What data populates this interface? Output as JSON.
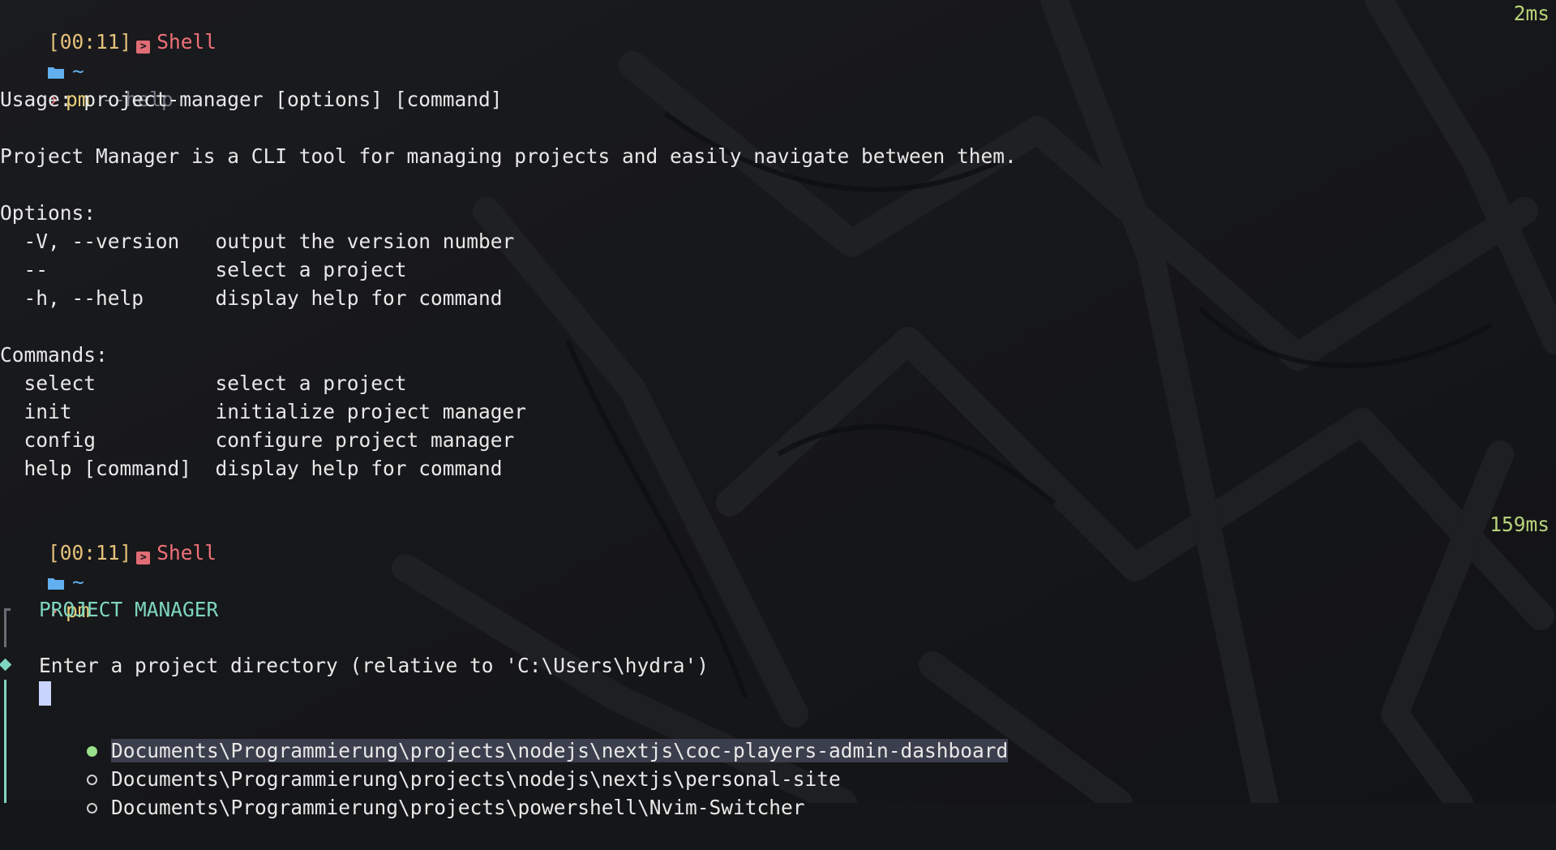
{
  "blocks": [
    {
      "time": "[00:11]",
      "shell": "Shell",
      "duration": "2ms",
      "cwd": "~",
      "command": "pm",
      "args": "--help"
    },
    {
      "time": "[00:11]",
      "shell": "Shell",
      "duration": "159ms",
      "cwd": "~",
      "command": "pm",
      "args": ""
    }
  ],
  "help": {
    "usage": "Usage: project-manager [options] [command]",
    "description": "Project Manager is a CLI tool for managing projects and easily navigate between them.",
    "options_header": "Options:",
    "options": [
      {
        "flag": "  -V, --version   ",
        "desc": "output the version number"
      },
      {
        "flag": "  --              ",
        "desc": "select a project"
      },
      {
        "flag": "  -h, --help      ",
        "desc": "display help for command"
      }
    ],
    "commands_header": "Commands:",
    "commands": [
      {
        "name": "  select          ",
        "desc": "select a project"
      },
      {
        "name": "  init            ",
        "desc": "initialize project manager"
      },
      {
        "name": "  config          ",
        "desc": "configure project manager"
      },
      {
        "name": "  help [command]  ",
        "desc": "display help for command"
      }
    ]
  },
  "tui": {
    "title": "PROJECT MANAGER",
    "question": "Enter a project directory (relative to 'C:\\Users\\hydra')",
    "input_value": "",
    "options": [
      {
        "label": "Documents\\Programmierung\\projects\\nodejs\\nextjs\\coc-players-admin-dashboard",
        "selected": true
      },
      {
        "label": "Documents\\Programmierung\\projects\\nodejs\\nextjs\\personal-site",
        "selected": false
      },
      {
        "label": "Documents\\Programmierung\\projects\\powershell\\Nvim-Switcher",
        "selected": false
      }
    ]
  },
  "colors": {
    "background": "#151618",
    "prompt_time": "#e5c07b",
    "shell_name": "#f07178",
    "duration": "#b8d47a",
    "accent_teal": "#7ed6c0",
    "folder": "#61afef"
  },
  "icons": {
    "shell": "terminal-box-icon",
    "cwd": "folder-icon",
    "prompt": "chevron-right-icon"
  }
}
